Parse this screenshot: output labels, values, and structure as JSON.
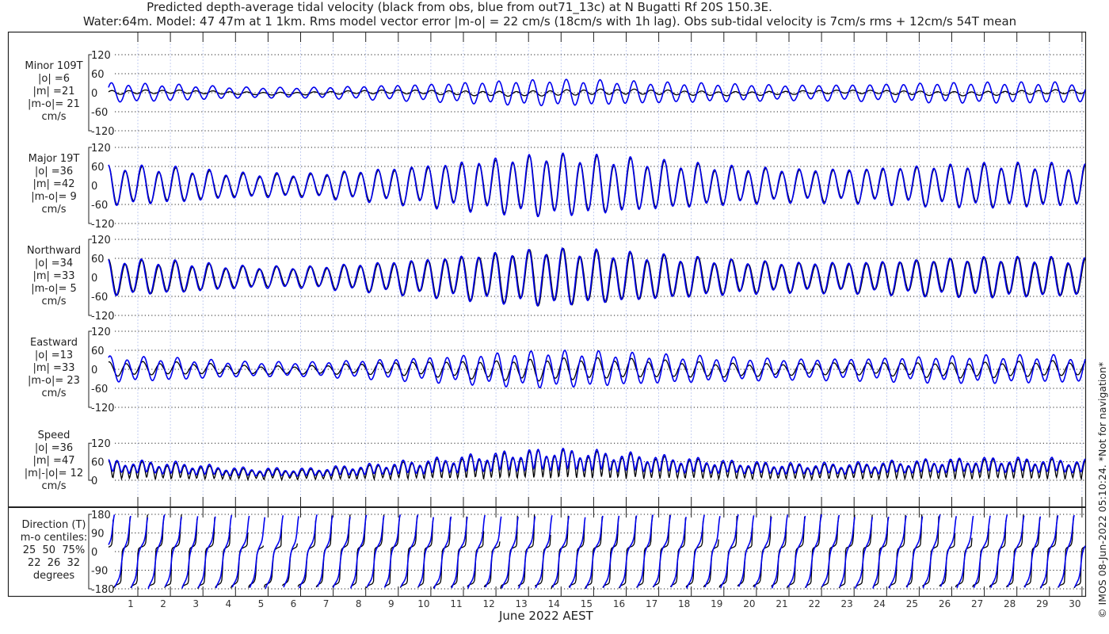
{
  "chart_data": {
    "type": "line",
    "title": "Predicted depth-average tidal velocity (black from obs, blue from out71_13c) at N Bugatti Rf 20S 150.3E.",
    "subtitle": "Water:64m. Model: 47 47m at 1 1km. Rms model vector error |m-o| = 22 cm/s (18cm/s with 1h lag). Obs sub-tidal velocity is 7cm/s rms + 12cm/s 54T mean",
    "xlabel": "June 2022 AEST",
    "x_ticks": [
      "1",
      "2",
      "3",
      "4",
      "5",
      "6",
      "7",
      "8",
      "9",
      "10",
      "11",
      "12",
      "13",
      "14",
      "15",
      "16",
      "17",
      "18",
      "19",
      "20",
      "21",
      "22",
      "23",
      "24",
      "25",
      "26",
      "27",
      "28",
      "29",
      "30"
    ],
    "colors": {
      "obs": "#000000",
      "model": "#0000ee",
      "grid_vertical": "#b8c4ee"
    },
    "series_names": {
      "obs": "obs",
      "model": "out71_13c"
    },
    "envelope_days": [
      0,
      2,
      4,
      6,
      8,
      10,
      12,
      13.5,
      15,
      17,
      19,
      21,
      23,
      25,
      27,
      29,
      30
    ],
    "major_amplitude_obs": [
      55,
      48,
      32,
      30,
      42,
      58,
      75,
      88,
      80,
      66,
      52,
      44,
      46,
      55,
      60,
      58,
      55
    ],
    "major_amplitude_model": [
      58,
      52,
      36,
      34,
      46,
      62,
      80,
      90,
      84,
      70,
      56,
      48,
      50,
      58,
      64,
      62,
      58
    ],
    "minor_amplitude_obs": [
      6,
      5,
      4,
      4,
      5,
      6,
      7,
      8,
      8,
      7,
      6,
      5,
      5,
      6,
      6,
      6,
      6
    ],
    "minor_amplitude_model": [
      28,
      24,
      16,
      15,
      20,
      26,
      34,
      38,
      36,
      30,
      26,
      22,
      24,
      28,
      30,
      30,
      28
    ],
    "panels": [
      {
        "key": "minor",
        "lines": [
          "Minor 109T",
          "|o| =6",
          "|m| =21",
          "|m-o|= 21",
          "cm/s"
        ],
        "yticks": [
          "120",
          "60",
          "0",
          "-60",
          "-120"
        ],
        "ylim": [
          -120,
          120
        ]
      },
      {
        "key": "major",
        "lines": [
          "Major 19T",
          "|o| =36",
          "|m| =42",
          "|m-o|= 9",
          "cm/s"
        ],
        "yticks": [
          "120",
          "60",
          "0",
          "-60",
          "-120"
        ],
        "ylim": [
          -120,
          120
        ]
      },
      {
        "key": "north",
        "lines": [
          "Northward",
          "|o| =34",
          "|m| =33",
          "|m-o|= 5",
          "cm/s"
        ],
        "yticks": [
          "120",
          "60",
          "0",
          "-60",
          "-120"
        ],
        "ylim": [
          -120,
          120
        ]
      },
      {
        "key": "east",
        "lines": [
          "Eastward",
          "|o| =13",
          "|m| =33",
          "|m-o|= 23",
          "cm/s"
        ],
        "yticks": [
          "120",
          "60",
          "0",
          "-60",
          "-120"
        ],
        "ylim": [
          -120,
          120
        ]
      },
      {
        "key": "speed",
        "lines": [
          "Speed",
          "|o| =36",
          "|m| =47",
          "|m|-|o|= 12",
          "cm/s"
        ],
        "yticks": [
          "120",
          "60",
          "0"
        ],
        "ylim": [
          0,
          120
        ]
      },
      {
        "key": "dir",
        "lines": [
          "Direction (T)",
          "m-o centiles:",
          "25  50  75%",
          "22  26  32",
          "degrees"
        ],
        "yticks": [
          "180",
          "90",
          "0",
          "-90",
          "-180"
        ],
        "ylim": [
          -180,
          180
        ]
      }
    ]
  },
  "credit": "© IMOS 08-Jun-2022 05:10:24. *Not for navigation*"
}
